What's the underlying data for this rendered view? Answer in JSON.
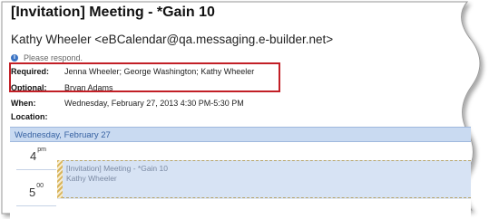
{
  "message": {
    "subject": "[Invitation] Meeting - *Gain 10",
    "sender": "Kathy Wheeler <eBCalendar@qa.messaging.e-builder.net>",
    "info_notice": "Please respond."
  },
  "details": {
    "required_label": "Required:",
    "required_value": "Jenna Wheeler; George Washington; Kathy Wheeler",
    "optional_label": "Optional:",
    "optional_value": "Bryan Adams",
    "when_label": "When:",
    "when_value": "Wednesday, February 27, 2013 4:30 PM-5:30 PM",
    "location_label": "Location:",
    "location_value": ""
  },
  "calendar": {
    "day_header": "Wednesday, February 27",
    "hours": [
      {
        "num": "4",
        "suffix": "pm"
      },
      {
        "num": "5",
        "suffix": "00"
      }
    ],
    "appointment": {
      "title": "[Invitation] Meeting - *Gain 10",
      "organizer": "Kathy Wheeler"
    }
  },
  "colors": {
    "highlight_border": "#c21f26",
    "day_header_bg": "#c9daf1",
    "appointment_bg": "#d7e3f4",
    "tentative_stripe": "#d9b45a"
  }
}
